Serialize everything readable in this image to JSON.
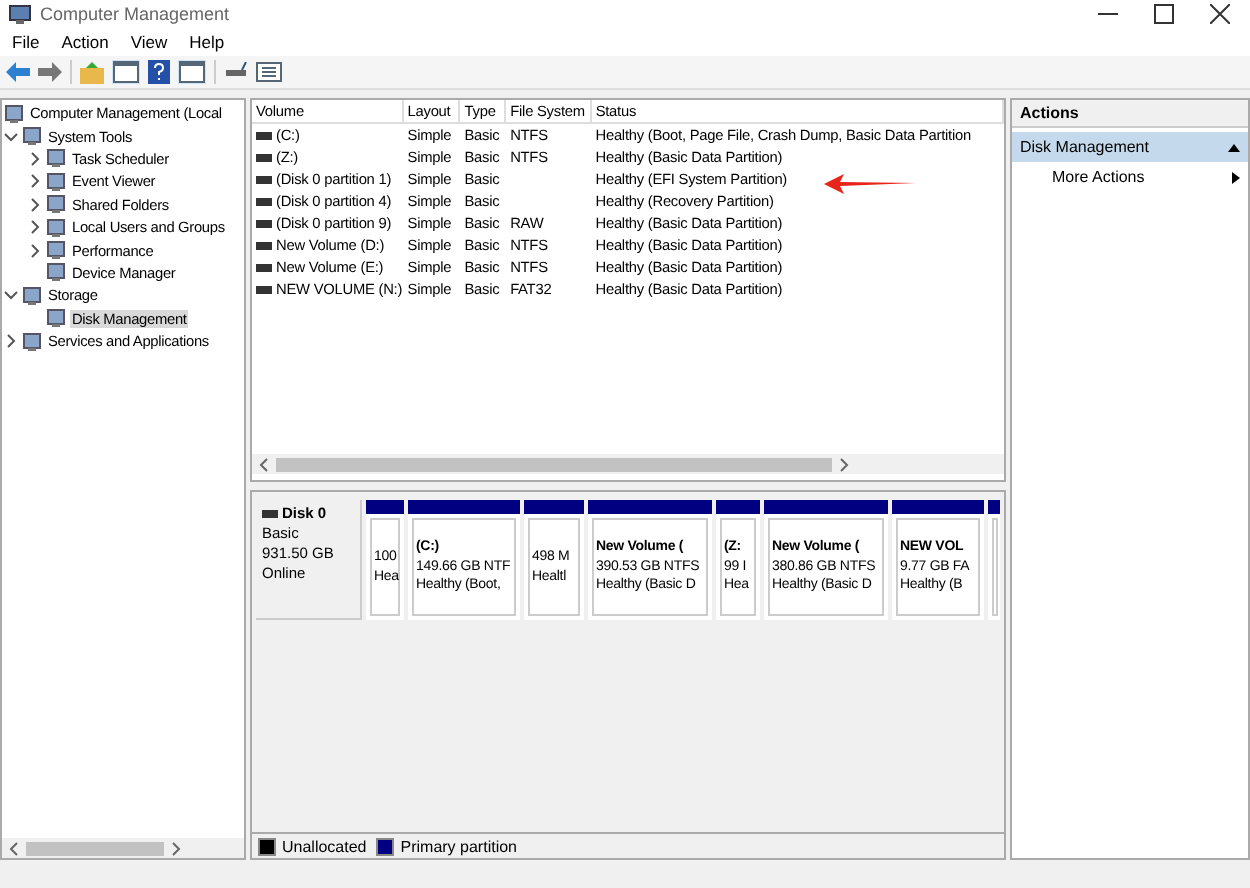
{
  "window": {
    "title": "Computer Management"
  },
  "menu": [
    "File",
    "Action",
    "View",
    "Help"
  ],
  "tree": [
    {
      "label": "Computer Management (Local",
      "selected": false,
      "children": [
        {
          "label": "System Tools",
          "expanded": true,
          "selected": false,
          "children": [
            {
              "label": "Task Scheduler",
              "expanded": false,
              "selected": false
            },
            {
              "label": "Event Viewer",
              "expanded": false,
              "selected": false
            },
            {
              "label": "Shared Folders",
              "expanded": false,
              "selected": false
            },
            {
              "label": "Local Users and Groups",
              "expanded": false,
              "selected": false
            },
            {
              "label": "Performance",
              "expanded": false,
              "selected": false
            },
            {
              "label": "Device Manager",
              "selected": false
            }
          ]
        },
        {
          "label": "Storage",
          "expanded": true,
          "selected": false,
          "children": [
            {
              "label": "Disk Management",
              "selected": true
            }
          ]
        },
        {
          "label": "Services and Applications",
          "expanded": false,
          "selected": false
        }
      ]
    }
  ],
  "table": {
    "columns": [
      "Volume",
      "Layout",
      "Type",
      "File System",
      "Status"
    ],
    "rows": [
      [
        "(C:)",
        "Simple",
        "Basic",
        "NTFS",
        "Healthy (Boot, Page File, Crash Dump, Basic Data Partition"
      ],
      [
        "(Z:)",
        "Simple",
        "Basic",
        "NTFS",
        "Healthy (Basic Data Partition)"
      ],
      [
        "(Disk 0 partition 1)",
        "Simple",
        "Basic",
        "",
        "Healthy (EFI System Partition)"
      ],
      [
        "(Disk 0 partition 4)",
        "Simple",
        "Basic",
        "",
        "Healthy (Recovery Partition)"
      ],
      [
        "(Disk 0 partition 9)",
        "Simple",
        "Basic",
        "RAW",
        "Healthy (Basic Data Partition)"
      ],
      [
        "New Volume (D:)",
        "Simple",
        "Basic",
        "NTFS",
        "Healthy (Basic Data Partition)"
      ],
      [
        "New Volume (E:)",
        "Simple",
        "Basic",
        "NTFS",
        "Healthy (Basic Data Partition)"
      ],
      [
        "NEW VOLUME (N:)",
        "Simple",
        "Basic",
        "FAT32",
        "Healthy (Basic Data Partition)"
      ]
    ]
  },
  "disk": {
    "name": "Disk 0",
    "type": "Basic",
    "size": "931.50 GB",
    "state": "Online",
    "partitions": [
      {
        "lines": [
          "100",
          "Hea"
        ]
      },
      {
        "name": "(C:)",
        "lines": [
          "149.66 GB NTF",
          "Healthy (Boot,"
        ]
      },
      {
        "lines": [
          "498 M",
          "Healtl"
        ]
      },
      {
        "name": "New Volume (",
        "lines": [
          "390.53 GB NTFS",
          "Healthy (Basic D"
        ]
      },
      {
        "name": "(Z:",
        "lines": [
          "99 I",
          "Hea"
        ]
      },
      {
        "name": "New Volume (",
        "lines": [
          "380.86 GB NTFS",
          "Healthy (Basic D"
        ]
      },
      {
        "name": "NEW VOL",
        "lines": [
          "9.77 GB FA",
          "Healthy (B"
        ]
      }
    ]
  },
  "legend": [
    {
      "label": "Unallocated",
      "color": "#000000"
    },
    {
      "label": "Primary partition",
      "color": "#000080"
    }
  ],
  "actions": {
    "title": "Actions",
    "section": "Disk Management",
    "items": [
      "More Actions"
    ]
  }
}
